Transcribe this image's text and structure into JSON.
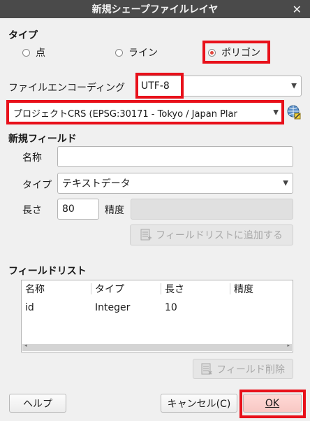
{
  "window": {
    "title": "新規シェープファイルレイヤ",
    "close_glyph": "✕"
  },
  "type_section": {
    "label": "タイプ",
    "options": [
      {
        "label": "点",
        "checked": false
      },
      {
        "label": "ライン",
        "checked": false
      },
      {
        "label": "ポリゴン",
        "checked": true
      }
    ]
  },
  "encoding": {
    "label": "ファイルエンコーディング",
    "value": "UTF-8"
  },
  "crs": {
    "value": "プロジェクトCRS (EPSG:30171 - Tokyo / Japan Plar",
    "icon": "crs-globe-icon"
  },
  "new_field": {
    "section_label": "新規フィールド",
    "name_label": "名称",
    "name_value": "",
    "type_label": "タイプ",
    "type_value": "テキストデータ",
    "length_label": "長さ",
    "length_value": "80",
    "precision_label": "精度",
    "precision_value": "",
    "add_button": "フィールドリストに追加する"
  },
  "field_list": {
    "section_label": "フィールドリスト",
    "headers": [
      "名称",
      "タイプ",
      "長さ",
      "精度"
    ],
    "rows": [
      {
        "name": "id",
        "type": "Integer",
        "length": "10",
        "precision": ""
      }
    ],
    "delete_button": "フィールド削除"
  },
  "buttons": {
    "help": "ヘルプ",
    "cancel": "キャンセル(C)",
    "ok": "OK"
  },
  "colors": {
    "highlight": "#e8101a",
    "titlebar": "#4a4a4a",
    "radio_checked": "#e0463c"
  }
}
